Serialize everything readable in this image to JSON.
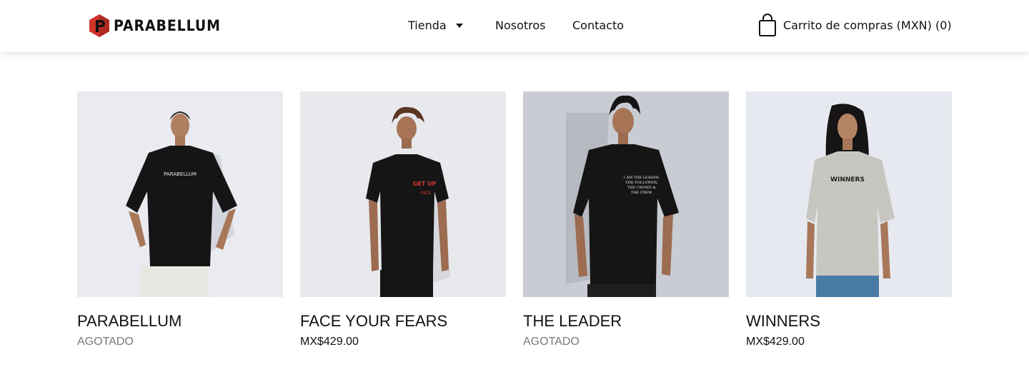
{
  "brand": {
    "name": "PARABELLUM",
    "logo_icon": "parabellum-hexagon-logo",
    "logo_color": "#d0352b"
  },
  "nav": {
    "items": [
      {
        "label": "Tienda",
        "has_dropdown": true,
        "icon": "caret-down-icon"
      },
      {
        "label": "Nosotros"
      },
      {
        "label": "Contacto"
      }
    ]
  },
  "cart": {
    "label": "Carrito de compras (MXN) (0)",
    "icon": "shopping-bag-icon"
  },
  "products": [
    {
      "name": "PARABELLUM",
      "status": "AGOTADO",
      "shirt_color": "#141414",
      "print_text": "PARABELLUM"
    },
    {
      "name": "FACE YOUR FEARS",
      "price": "MX$429.00",
      "shirt_color": "#141414",
      "print_color": "#d2382c"
    },
    {
      "name": "THE LEADER",
      "status": "AGOTADO",
      "shirt_color": "#141414"
    },
    {
      "name": "WINNERS",
      "price": "MX$429.00",
      "shirt_color": "#c8c6c0",
      "print_text": "WINNERS"
    }
  ],
  "colors": {
    "status_gray": "#7a7a7a",
    "photo_bg": "#e6e9ee"
  }
}
